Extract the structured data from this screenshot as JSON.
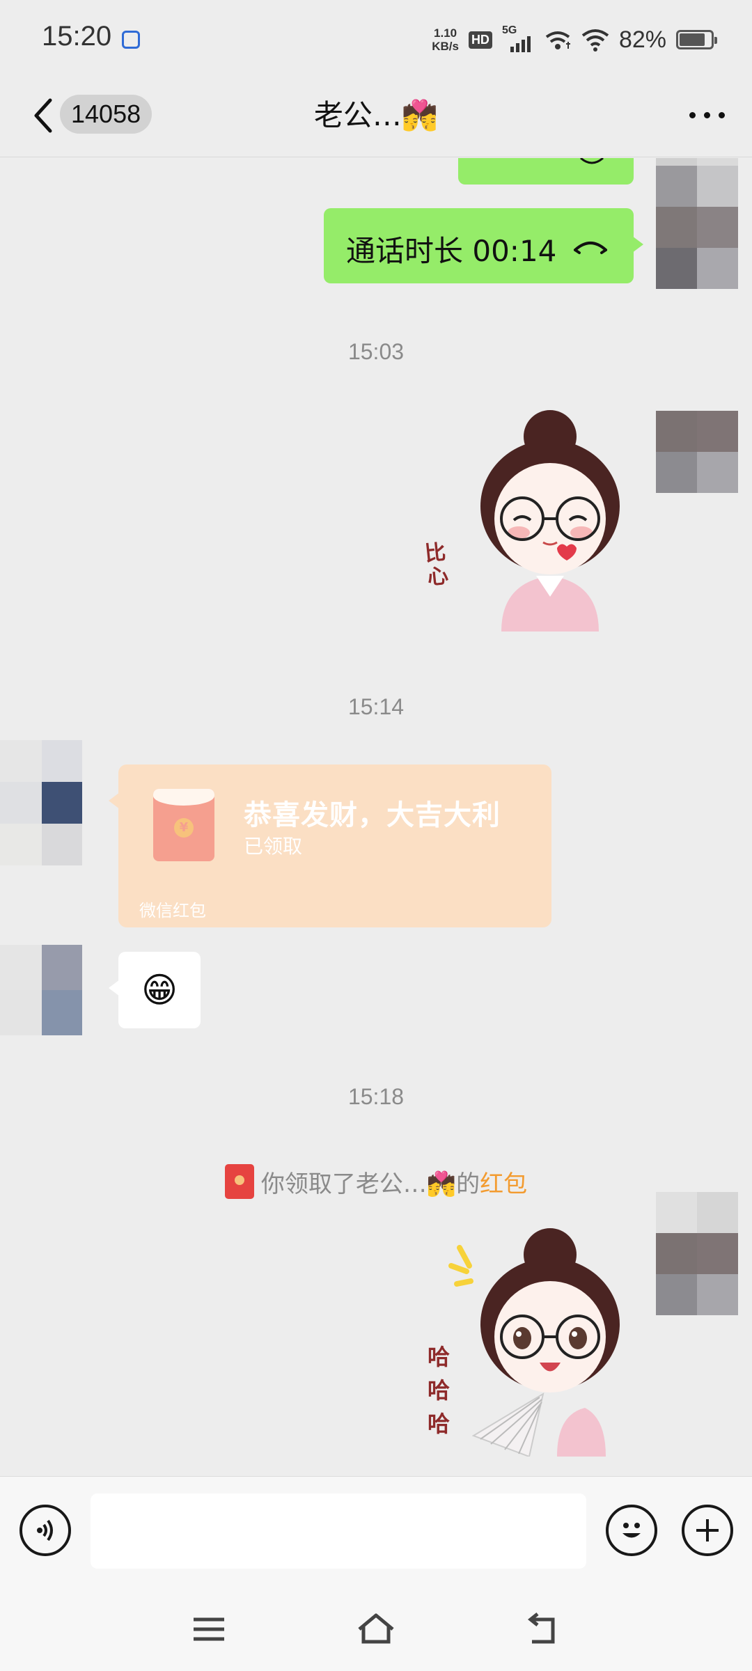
{
  "status_bar": {
    "time": "15:20",
    "net_speed_value": "1.10",
    "net_speed_unit": "KB/s",
    "hd_badge": "HD",
    "network_type": "5G",
    "battery_percent": "82%",
    "battery_level": 0.82
  },
  "nav": {
    "unread_count": "14058",
    "title": "老公…💏"
  },
  "messages": {
    "call": {
      "text": "通话时长 00:14"
    },
    "timestamps": [
      "15:03",
      "15:14",
      "15:18"
    ],
    "sticker1_caption": "比心",
    "red_packet": {
      "title": "恭喜发财，大吉大利",
      "status": "已领取",
      "brand": "微信红包",
      "coin_glyph": "¥"
    },
    "emoji_reply": "😁",
    "system_notice": {
      "prefix": "你领取了老公…💏的",
      "link": "红包"
    },
    "sticker2_caption": [
      "哈",
      "哈",
      "哈"
    ]
  },
  "colors": {
    "sent_bubble": "#95ec69",
    "red_packet_received": "#fbdfc4",
    "link_orange": "#f39b2f"
  },
  "icons": {
    "back": "chevron-left-icon",
    "more": "more-icon",
    "voice": "voice-icon",
    "emoji": "emoji-icon",
    "add": "plus-icon",
    "menu": "menu-icon",
    "home": "home-icon",
    "return": "back-arrow-icon"
  }
}
